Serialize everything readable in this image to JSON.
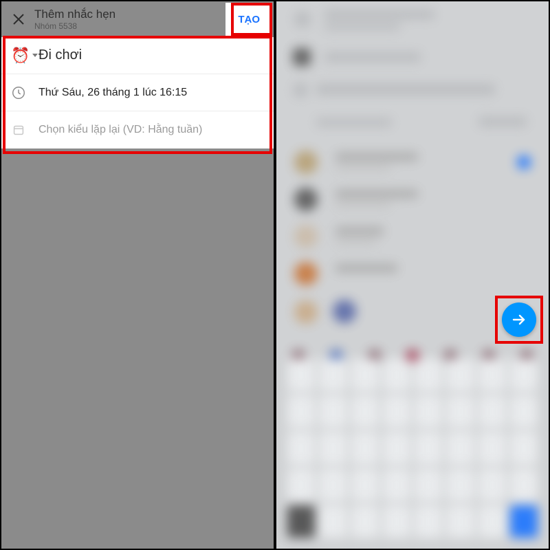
{
  "left": {
    "header": {
      "title": "Thêm nhắc hẹn",
      "subtitle": "Nhóm 5538",
      "create_label": "TẠO"
    },
    "rows": {
      "title_value": "Đi chơi",
      "datetime": "Thứ Sáu, 26 tháng 1 lúc 16:15",
      "repeat_placeholder": "Chọn kiểu lặp lại (VD: Hằng tuần)"
    }
  },
  "right": {
    "fab_icon": "arrow-right-icon"
  },
  "colors": {
    "accent": "#0096ff",
    "highlight": "#e60000"
  }
}
